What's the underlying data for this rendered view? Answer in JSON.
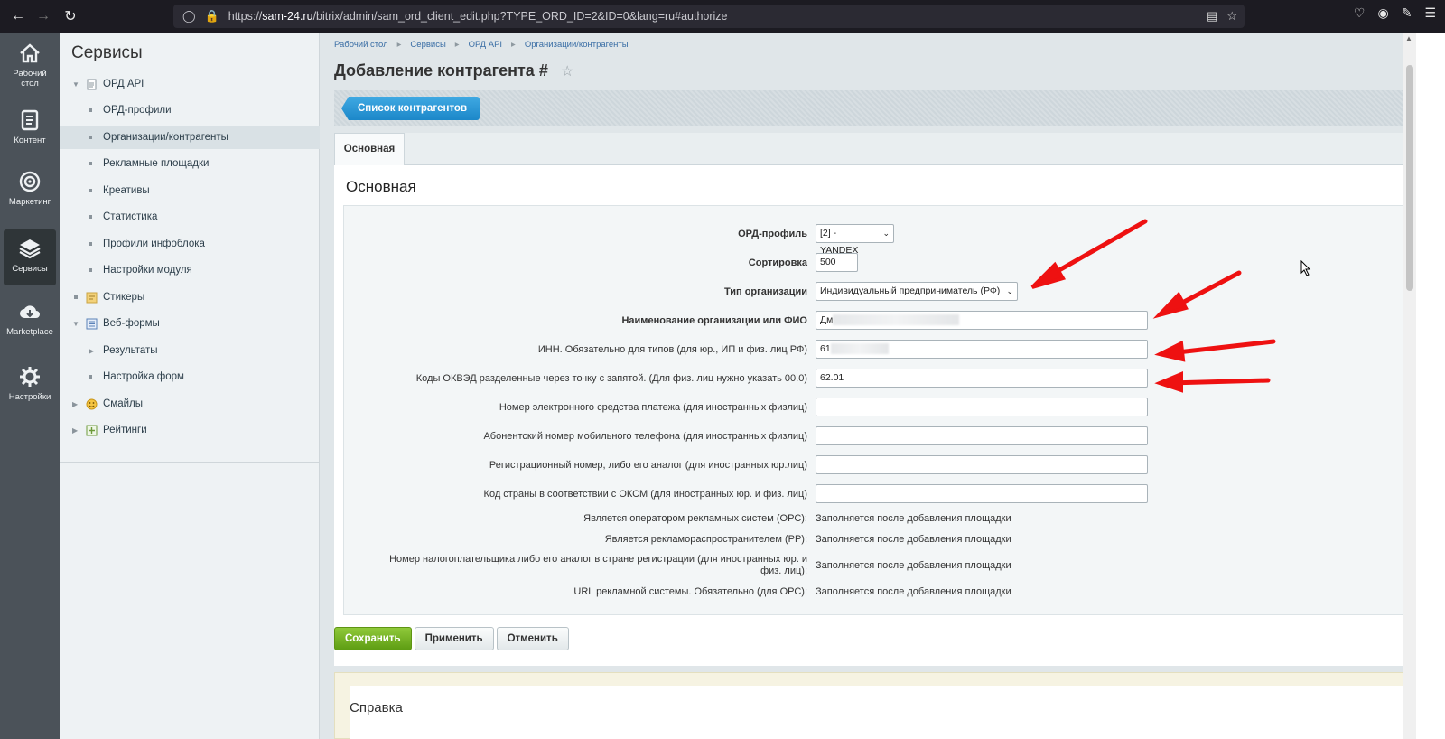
{
  "browser": {
    "url_prefix": "https://",
    "url_host": "sam-24.ru",
    "url_path": "/bitrix/admin/sam_ord_client_edit.php?TYPE_ORD_ID=2&ID=0&lang=ru#authorize"
  },
  "rail": [
    {
      "label": "Рабочий стол",
      "icon": "home-icon"
    },
    {
      "label": "Контент",
      "icon": "document-icon"
    },
    {
      "label": "Маркетинг",
      "icon": "target-icon"
    },
    {
      "label": "Сервисы",
      "icon": "layers-icon"
    },
    {
      "label": "Marketplace",
      "icon": "cloud-download-icon"
    },
    {
      "label": "Настройки",
      "icon": "gear-icon"
    }
  ],
  "menu": {
    "title": "Сервисы",
    "items": [
      {
        "label": "ОРД API"
      },
      {
        "label": "ОРД-профили"
      },
      {
        "label": "Организации/контрагенты"
      },
      {
        "label": "Рекламные площадки"
      },
      {
        "label": "Креативы"
      },
      {
        "label": "Статистика"
      },
      {
        "label": "Профили инфоблока"
      },
      {
        "label": "Настройки модуля"
      },
      {
        "label": "Стикеры"
      },
      {
        "label": "Веб-формы"
      },
      {
        "label": "Результаты"
      },
      {
        "label": "Настройка форм"
      },
      {
        "label": "Смайлы"
      },
      {
        "label": "Рейтинги"
      }
    ]
  },
  "breadcrumb": [
    "Рабочий стол",
    "Сервисы",
    "ОРД API",
    "Организации/контрагенты"
  ],
  "page_title": "Добавление контрагента #",
  "toolbar": {
    "list_button": "Список контрагентов"
  },
  "tabs": [
    {
      "label": "Основная"
    }
  ],
  "section_title": "Основная",
  "form": {
    "ord_profile": {
      "label": "ОРД-профиль",
      "value": "[2] - YANDEX"
    },
    "sort": {
      "label": "Сортировка",
      "value": "500"
    },
    "org_type": {
      "label": "Тип организации",
      "value": "Индивидуальный предприниматель (РФ)"
    },
    "name": {
      "label": "Наименование организации или ФИО",
      "value": "Дм"
    },
    "inn": {
      "label": "ИНН. Обязательно для типов (для юр., ИП и физ. лиц РФ)",
      "value": "61"
    },
    "okved": {
      "label": "Коды ОКВЭД разделенные через точку с запятой. (Для физ. лиц нужно указать 00.0)",
      "value": "62.01"
    },
    "epay": {
      "label": "Номер электронного средства платежа (для иностранных физлиц)",
      "value": ""
    },
    "phone": {
      "label": "Абонентский номер мобильного телефона (для иностранных физлиц)",
      "value": ""
    },
    "regnum": {
      "label": "Регистрационный номер, либо его аналог (для иностранных юр.лиц)",
      "value": ""
    },
    "oksm": {
      "label": "Код страны в соответствии с ОКСМ (для иностранных юр. и физ. лиц)",
      "value": ""
    },
    "ors": {
      "label": "Является оператором рекламных систем (ОРС):",
      "value": "Заполняется после добавления площадки"
    },
    "rr": {
      "label": "Является рекламораспространителем (РР):",
      "value": "Заполняется после добавления площадки"
    },
    "taxnum": {
      "label": "Номер налогоплательщика либо его аналог в стране регистрации (для иностранных юр. и физ. лиц):",
      "value": "Заполняется после добавления площадки"
    },
    "url": {
      "label": "URL рекламной системы. Обязательно (для ОРС):",
      "value": "Заполняется после добавления площадки"
    }
  },
  "buttons": {
    "save": "Сохранить",
    "apply": "Применить",
    "cancel": "Отменить"
  },
  "help_title": "Справка",
  "colors": {
    "annotation_arrow": "#ee1111",
    "save_button": "#6aaa1a",
    "list_button": "#2b97d6"
  }
}
